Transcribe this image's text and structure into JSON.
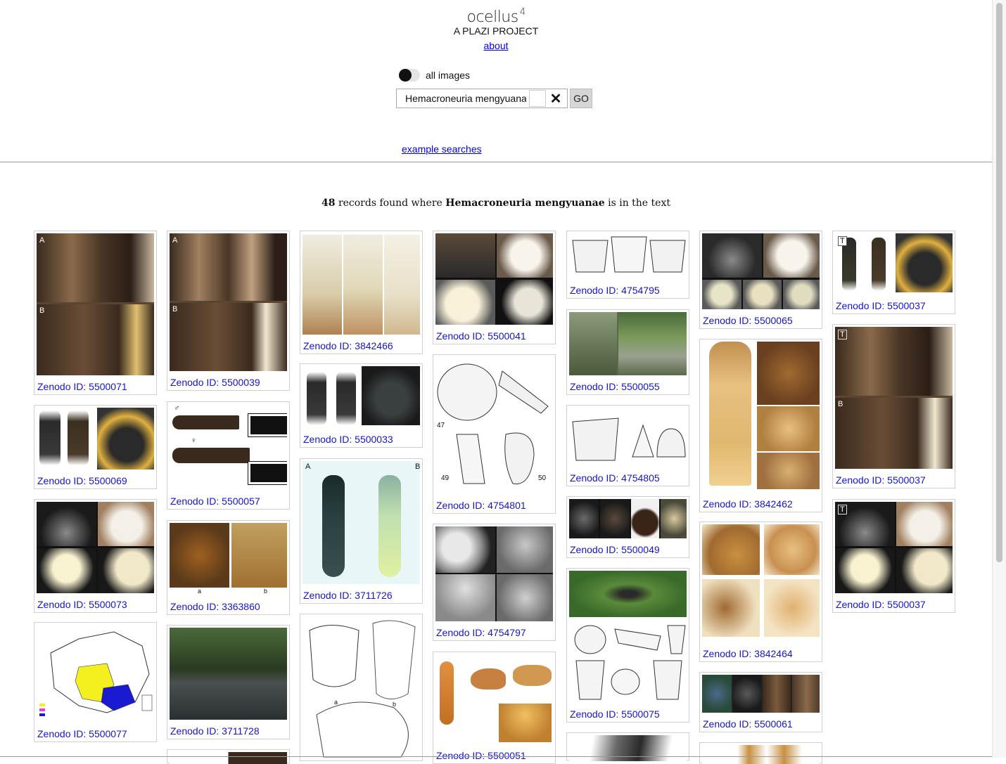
{
  "app": {
    "logo_text": "ocellus",
    "logo_sup": "4",
    "tagline": "A PLAZI PROJECT",
    "about_link": "about"
  },
  "controls": {
    "toggle_label": "all images",
    "search_value": "Hemacroneuria mengyuanae",
    "clear_label": "✕",
    "go_label": "GO",
    "examples_link": "example searches"
  },
  "summary": {
    "count": "48",
    "text1": "records found where",
    "term": "Hemacroneuria mengyuanae",
    "text2": "is in the text"
  },
  "colors": {
    "link": "#0000ee",
    "caption": "#1515cc"
  },
  "results": [
    {
      "caption": "Zenodo ID: 5500071",
      "image": "stonefly-abdomen-dorsal-ventral"
    },
    {
      "caption": "Zenodo ID: 5500039",
      "image": "stonefly-abdomen-dorsal-ventral"
    },
    {
      "caption": "Zenodo ID: 3842466",
      "image": "genitalia-line-drawings"
    },
    {
      "caption": "Zenodo ID: 5500041",
      "image": "genitalia-photos"
    },
    {
      "caption": "Zenodo ID: 4754795",
      "image": "head-line-drawings"
    },
    {
      "caption": "Zenodo ID: 5500065",
      "image": "genitalia-photos"
    },
    {
      "caption": "Zenodo ID: 5500037",
      "image": "adult-habitus-and-head"
    },
    {
      "caption": "Zenodo ID: 5500069",
      "image": "adult-habitus-and-head"
    },
    {
      "caption": "Zenodo ID: 5500057",
      "image": "pinned-specimens-with-labels"
    },
    {
      "caption": "Zenodo ID: 5500033",
      "image": "adult-habitus-and-head"
    },
    {
      "caption": "Zenodo ID: 4754801",
      "image": "larva-line-drawings"
    },
    {
      "caption": "Zenodo ID: 5500055",
      "image": "habitat-stream-photos"
    },
    {
      "caption": "Zenodo ID: 3842462",
      "image": "adult-habitus-and-genitalia"
    },
    {
      "caption": "Zenodo ID: 5500037",
      "image": "stonefly-abdomen-dorsal-ventral"
    },
    {
      "caption": "Zenodo ID: 5500073",
      "image": "genitalia-photos"
    },
    {
      "caption": "Zenodo ID: 3363860",
      "image": "head-pronotum-photos"
    },
    {
      "caption": "Zenodo ID: 3711726",
      "image": "adult-habitus-two-views"
    },
    {
      "caption": "Zenodo ID: 4754797",
      "image": "egg-sem-micrographs"
    },
    {
      "caption": "Zenodo ID: 4754805",
      "image": "head-line-drawings"
    },
    {
      "caption": "Zenodo ID: 5500049",
      "image": "genitalia-photos"
    },
    {
      "caption": "Zenodo ID: 5500037",
      "image": "genitalia-photos"
    },
    {
      "caption": "Zenodo ID: 5500077",
      "image": "distribution-map-china"
    },
    {
      "caption": "Zenodo ID: 3711728",
      "image": "habitat-stream-photo"
    },
    {
      "caption": "Zenodo ID: 5500075",
      "image": "adult-photo-and-drawings"
    },
    {
      "caption": "Zenodo ID: 3842464",
      "image": "genitalia-photos"
    },
    {
      "caption": "Zenodo ID: 5500051",
      "image": "larva-habitus-and-details"
    },
    {
      "caption": "Zenodo ID: 5500061",
      "image": "adult-and-abdomen-photos"
    }
  ]
}
